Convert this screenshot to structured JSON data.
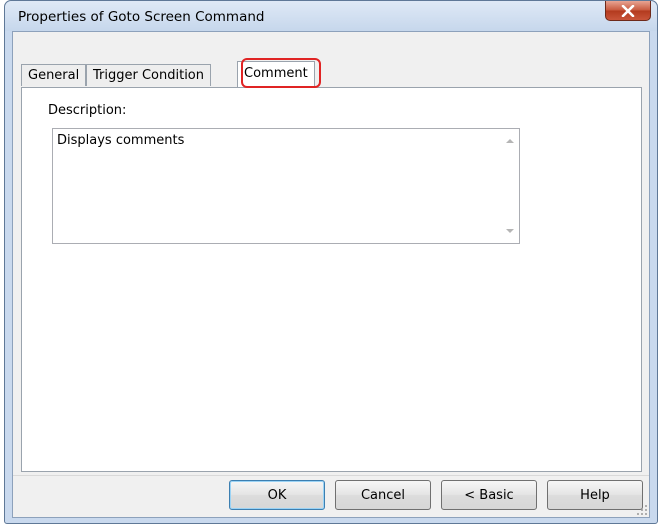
{
  "window": {
    "title": "Properties of Goto Screen Command",
    "close_icon": "close-x-icon",
    "accent_close": "#c85a3f"
  },
  "tabs": [
    {
      "label": "General",
      "active": false
    },
    {
      "label": "Trigger Condition",
      "active": false
    },
    {
      "label": "Comment",
      "active": true
    }
  ],
  "comment_panel": {
    "description_label": "Description:",
    "description_value": "Displays comments"
  },
  "buttons": {
    "ok": "OK",
    "cancel": "Cancel",
    "basic": "< Basic",
    "help": "Help"
  },
  "highlight_color": "#e02424"
}
